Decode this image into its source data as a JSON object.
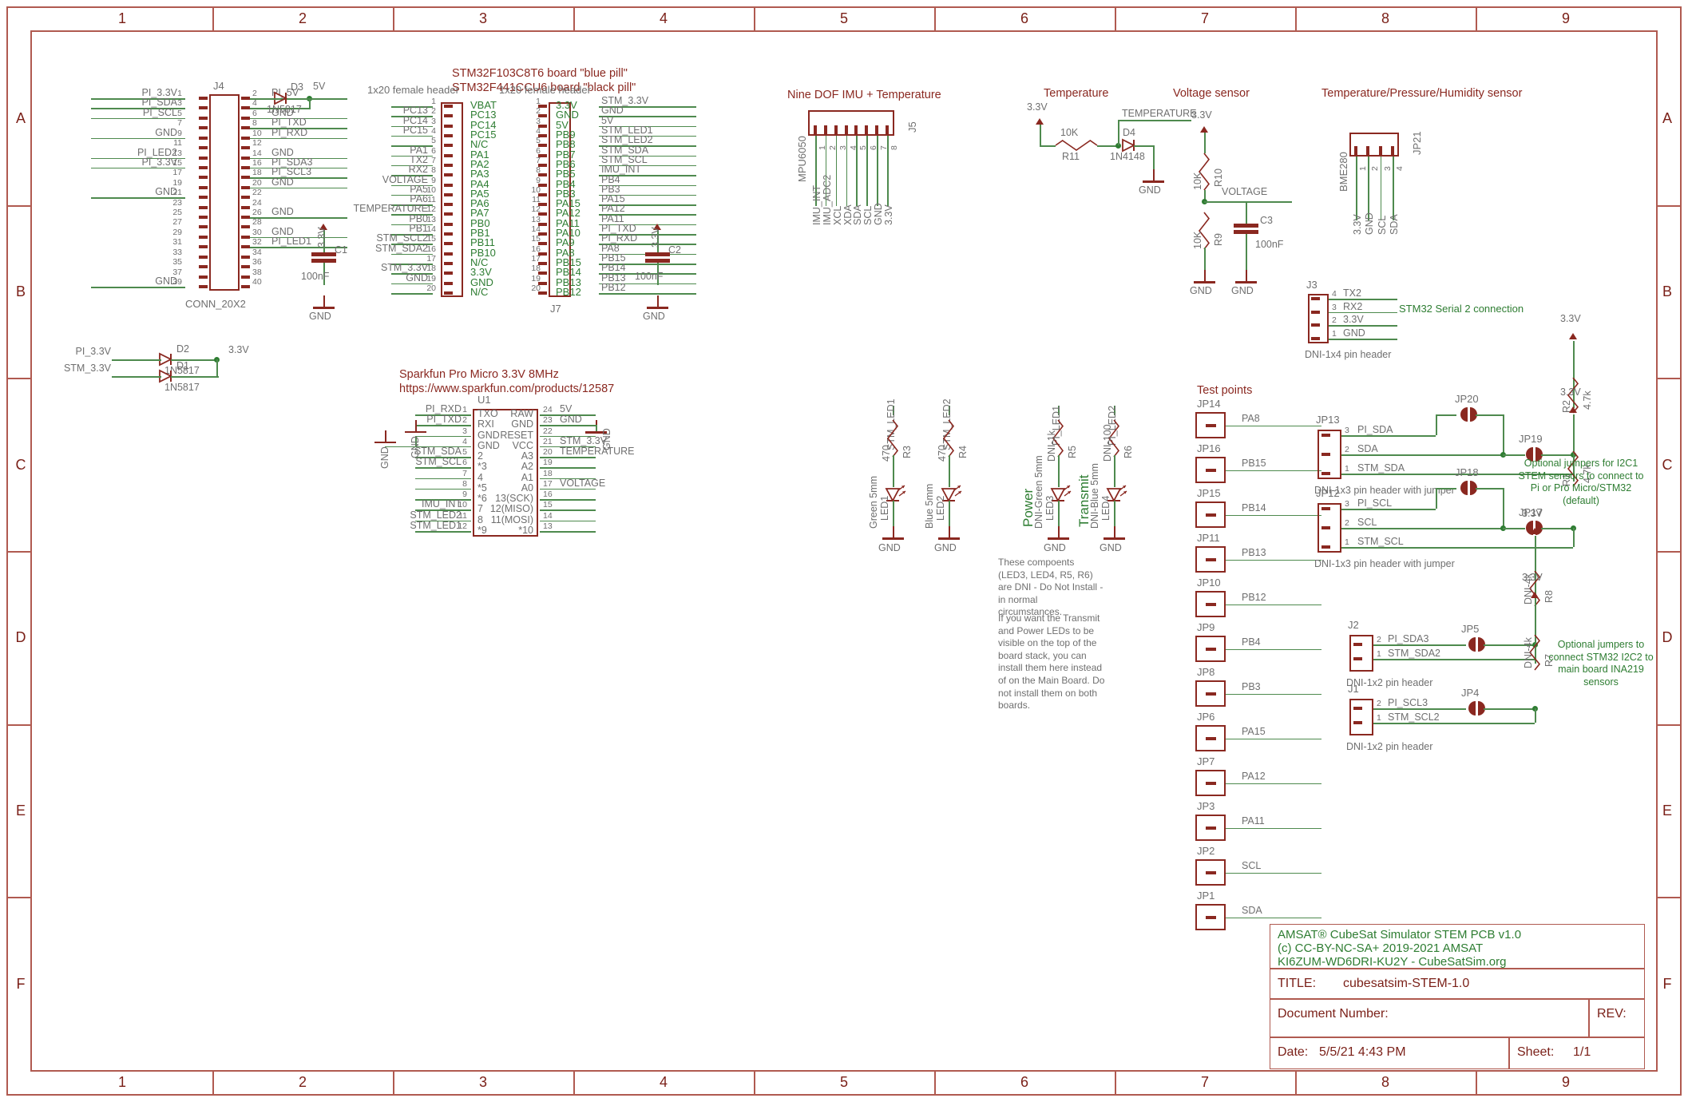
{
  "sheet": {
    "columns": [
      "1",
      "2",
      "3",
      "4",
      "5",
      "6",
      "7",
      "8",
      "9"
    ],
    "rows": [
      "A",
      "B",
      "C",
      "D",
      "E",
      "F"
    ]
  },
  "title_block": {
    "line1": "AMSAT® CubeSat Simulator STEM PCB v1.0",
    "line2": "(c) CC-BY-NC-SA+   2019-2021 AMSAT",
    "line3": "KI6ZUM-WD6DRI-KU2Y - CubeSatSim.org",
    "title_label": "TITLE:",
    "title_value": "cubesatsim-STEM-1.0",
    "docnum_label": "Document Number:",
    "rev_label": "REV:",
    "date_label": "Date:",
    "date_value": "5/5/21 4:43 PM",
    "sheet_label": "Sheet:",
    "sheet_value": "1/1"
  },
  "j4": {
    "ref": "J4",
    "footprint": "CONN_20X2",
    "left_nets": [
      "PI_3.3V",
      "PI_SDA",
      "PI_SCL",
      "",
      "GND",
      "",
      "PI_LED2",
      "PI_3.3V",
      "",
      "",
      "GND",
      "",
      "",
      "",
      "",
      "",
      "",
      "",
      "",
      "GND"
    ],
    "right_nets": [
      "PI_5V",
      "",
      "GND",
      "PI_TXD",
      "PI_RXD",
      "",
      "GND",
      "PI_SDA3",
      "PI_SCL3",
      "GND",
      "",
      "",
      "GND",
      "",
      "GND",
      "PI_LED1",
      "",
      "",
      "",
      ""
    ],
    "left_pins": [
      "1",
      "3",
      "5",
      "7",
      "9",
      "11",
      "13",
      "15",
      "17",
      "19",
      "21",
      "23",
      "25",
      "27",
      "29",
      "31",
      "33",
      "35",
      "37",
      "39"
    ],
    "right_pins": [
      "2",
      "4",
      "6",
      "8",
      "10",
      "12",
      "14",
      "16",
      "18",
      "20",
      "22",
      "24",
      "26",
      "28",
      "30",
      "32",
      "34",
      "36",
      "38",
      "40"
    ]
  },
  "d3": {
    "ref": "D3",
    "value": "1N5817",
    "net": "5V"
  },
  "d2": {
    "ref": "D2",
    "value": "1N5817",
    "in": "PI_3.3V",
    "out": "3.3V"
  },
  "d1": {
    "ref": "D1",
    "value": "1N5817",
    "in": "STM_3.3V"
  },
  "stm_title": {
    "line1": "STM32F103C8T6 board \"blue pill\"",
    "line2": "STM32F441CCU6 board \"black pill\"",
    "header_label": "1x20 female header"
  },
  "j6": {
    "ref": "",
    "nets": [
      "",
      "PC13",
      "PC14",
      "PC15",
      "",
      "PA1",
      "TX2",
      "RX2",
      "VOLTAGE",
      "PA5",
      "PA6",
      "TEMPERATURE",
      "PB0",
      "PB1",
      "STM_SCL2",
      "STM_SDA2",
      "",
      "STM_3.3V",
      "GND",
      ""
    ],
    "pins": [
      "1",
      "2",
      "3",
      "4",
      "5",
      "6",
      "7",
      "8",
      "9",
      "10",
      "11",
      "12",
      "13",
      "14",
      "15",
      "16",
      "17",
      "18",
      "19",
      "20"
    ],
    "func": [
      "VBAT",
      "PC13",
      "PC14",
      "PC15",
      "N/C",
      "PA1",
      "PA2",
      "PA3",
      "PA4",
      "PA5",
      "PA6",
      "PA7",
      "PB0",
      "PB1",
      "PB11",
      "PB10",
      "N/C",
      "3.3V",
      "GND",
      "N/C"
    ]
  },
  "j7": {
    "ref": "J7",
    "func": [
      "3.3V",
      "GND",
      "5V",
      "PB9",
      "PB8",
      "PB7",
      "PB6",
      "PB5",
      "PB4",
      "PB3",
      "PA15",
      "PA12",
      "PA11",
      "PA10",
      "PA9",
      "PA8",
      "PB15",
      "PB14",
      "PB13",
      "PB12"
    ],
    "pins": [
      "1",
      "2",
      "3",
      "4",
      "5",
      "6",
      "7",
      "8",
      "9",
      "10",
      "11",
      "12",
      "13",
      "14",
      "15",
      "16",
      "17",
      "18",
      "19",
      "20"
    ],
    "nets": [
      "STM_3.3V",
      "GND",
      "5V",
      "STM_LED1",
      "STM_LED2",
      "STM_SDA",
      "STM_SCL",
      "IMU_INT",
      "PB4",
      "PB3",
      "PA15",
      "PA12",
      "PA11",
      "PI_TXD",
      "PI_RXD",
      "PA8",
      "PB15",
      "PB14",
      "PB13",
      "PB12"
    ]
  },
  "c1": {
    "ref": "C1",
    "value": "100nF",
    "top": "3.3V",
    "bottom": "GND"
  },
  "c2": {
    "ref": "C2",
    "value": "100nF",
    "top": "3.3V",
    "bottom": "GND"
  },
  "promicro": {
    "title1": "Sparkfun Pro Micro 3.3V 8MHz",
    "title2": "https://www.sparkfun.com/products/12587",
    "ref": "U1",
    "left_func": [
      "TXO",
      "RXI",
      "GND",
      "GND",
      "2",
      "*3",
      "4",
      "*5",
      "*6",
      "7",
      "8",
      "*9"
    ],
    "left_pins": [
      "1",
      "2",
      "3",
      "4",
      "5",
      "6",
      "7",
      "8",
      "9",
      "10",
      "11",
      "12"
    ],
    "left_nets": [
      "PI_RXD",
      "PI_TXD",
      "",
      "",
      "STM_SDA",
      "STM_SCL",
      "",
      "",
      "",
      "IMU_INT",
      "STM_LED2",
      "STM_LED1"
    ],
    "right_func": [
      "RAW",
      "GND",
      "RESET",
      "VCC",
      "A3",
      "A2",
      "A1",
      "A0",
      "13(SCK)",
      "12(MISO)",
      "11(MOSI)",
      "*10"
    ],
    "right_pins": [
      "24",
      "23",
      "22",
      "21",
      "20",
      "19",
      "18",
      "17",
      "16",
      "15",
      "14",
      "13"
    ],
    "right_nets": [
      "5V",
      "GND",
      "",
      "STM_3.3V",
      "TEMPERATURE",
      "",
      "",
      "VOLTAGE",
      "",
      "",
      "",
      ""
    ],
    "gnd_left_1": "GND",
    "gnd_left_2": "GND"
  },
  "imu": {
    "title": "Nine DOF IMU + Temperature",
    "part": "MPU6050",
    "ref": "J5",
    "pins": [
      "1",
      "2",
      "3",
      "4",
      "5",
      "6",
      "7",
      "8"
    ],
    "nets": [
      "IMU_INT",
      "IMU_ADC2",
      "XCL",
      "XDA",
      "SDA",
      "SCL",
      "GND",
      "3.3V"
    ]
  },
  "temp_sensor": {
    "title": "Temperature",
    "vcc": "3.3V",
    "r_value": "10K",
    "r_ref": "R11",
    "d_ref": "D4",
    "d_value": "1N4148",
    "out": "TEMPERATURE",
    "gnd": "GND"
  },
  "voltage_sensor": {
    "title": "Voltage sensor",
    "vcc": "3.3V",
    "r10_value": "10K",
    "r10_ref": "R10",
    "r9_value": "10K",
    "r9_ref": "R9",
    "out": "VOLTAGE",
    "c3_ref": "C3",
    "c3_value": "100nF",
    "gnd1": "GND",
    "gnd2": "GND"
  },
  "bme280": {
    "title": "Temperature/Pressure/Humidity sensor",
    "part": "BME280",
    "ref": "JP21",
    "pins": [
      "1",
      "2",
      "3",
      "4"
    ],
    "nets": [
      "3.3V",
      "GND",
      "SCL",
      "SDA"
    ]
  },
  "j3": {
    "ref": "J3",
    "note": "STM32 Serial 2 connection",
    "footprint": "DNI-1x4 pin header",
    "pins": [
      "4",
      "3",
      "2",
      "1"
    ],
    "nets": [
      "TX2",
      "RX2",
      "3.3V",
      "GND"
    ]
  },
  "leds": [
    {
      "ref": "LED1",
      "desc": "Green 5mm",
      "r_value": "470",
      "r_ref": "R3",
      "net": "STM_LED1",
      "gnd": "GND",
      "label": ""
    },
    {
      "ref": "LED2",
      "desc": "Blue 5mm",
      "r_value": "470",
      "r_ref": "R4",
      "net": "STM_LED2",
      "gnd": "GND",
      "label": ""
    },
    {
      "ref": "LED3",
      "desc": "DNI-Green 5mm",
      "r_value": "DNI-1k",
      "r_ref": "R5",
      "net": "PI_LED1",
      "gnd": "GND",
      "label": "Power"
    },
    {
      "ref": "LED4",
      "desc": "DNI-Blue 5mm",
      "r_value": "DNI-100",
      "r_ref": "R6",
      "net": "PI_LED2",
      "gnd": "GND",
      "label": "Transmit"
    }
  ],
  "dni_note": {
    "p1": "These compoents (LED3, LED4, R5, R6) are DNI - Do Not Install - in normal circumstances.",
    "p2": "If you want the Transmit and Power LEDs to be visible on the top of the board stack, you can install them here instead of on the Main Board. Do not install them on both boards."
  },
  "test_points": {
    "title": "Test points",
    "items": [
      {
        "ref": "JP14",
        "net": "PA8"
      },
      {
        "ref": "JP16",
        "net": "PB15"
      },
      {
        "ref": "JP15",
        "net": "PB14"
      },
      {
        "ref": "JP11",
        "net": "PB13"
      },
      {
        "ref": "JP10",
        "net": "PB12"
      },
      {
        "ref": "JP9",
        "net": "PB4"
      },
      {
        "ref": "JP8",
        "net": "PB3"
      },
      {
        "ref": "JP6",
        "net": "PA15"
      },
      {
        "ref": "JP7",
        "net": "PA12"
      },
      {
        "ref": "JP3",
        "net": "PA11"
      },
      {
        "ref": "JP2",
        "net": "SCL"
      },
      {
        "ref": "JP1",
        "net": "SDA"
      }
    ]
  },
  "i2c1": {
    "jp13": {
      "ref": "JP13",
      "pins": [
        "3",
        "2",
        "1"
      ],
      "nets": [
        "PI_SDA",
        "SDA",
        "STM_SDA"
      ],
      "footprint": "DNI-1x3 pin header with jumper"
    },
    "jp12": {
      "ref": "JP12",
      "pins": [
        "3",
        "2",
        "1"
      ],
      "nets": [
        "PI_SCL",
        "SCL",
        "STM_SCL"
      ],
      "footprint": "DNI-1x3 pin header with jumper"
    },
    "jp20": "JP20",
    "jp19": "JP19",
    "jp18": "JP18",
    "jp17": "JP17",
    "r2_ref": "R2",
    "r2_value": "4.7k",
    "r2_vcc": "3.3V",
    "r1_ref": "R1",
    "r1_value": "4.7k",
    "r1_vcc": "3.3V",
    "note": "Optional jumpers for I2C1 STEM sensors to connect to Pi or Pro Micro/STM32 (default)"
  },
  "i2c2": {
    "j2": {
      "ref": "J2",
      "pins": [
        "2",
        "1"
      ],
      "nets": [
        "PI_SDA3",
        "STM_SDA2"
      ],
      "footprint": "DNI-1x2 pin header"
    },
    "j1": {
      "ref": "J1",
      "pins": [
        "2",
        "1"
      ],
      "nets": [
        "PI_SCL3",
        "STM_SCL2"
      ],
      "footprint": "DNI-1x2 pin header"
    },
    "jp5": "JP5",
    "jp4": "JP4",
    "r8_ref": "R8",
    "r8_value": "DNI-4k",
    "r8_vcc": "3.3V",
    "r7_ref": "R7",
    "r7_value": "DNI-4k",
    "r7_vcc": "3.3V",
    "note": "Optional jumpers to connect STM32 I2C2 to main board INA219 sensors"
  },
  "colors": {
    "wire": "#4e8a4e",
    "symbol": "#8a2820",
    "label": "#6f6f6f",
    "pinname": "#2e7d32",
    "frame": "#b05a50"
  }
}
